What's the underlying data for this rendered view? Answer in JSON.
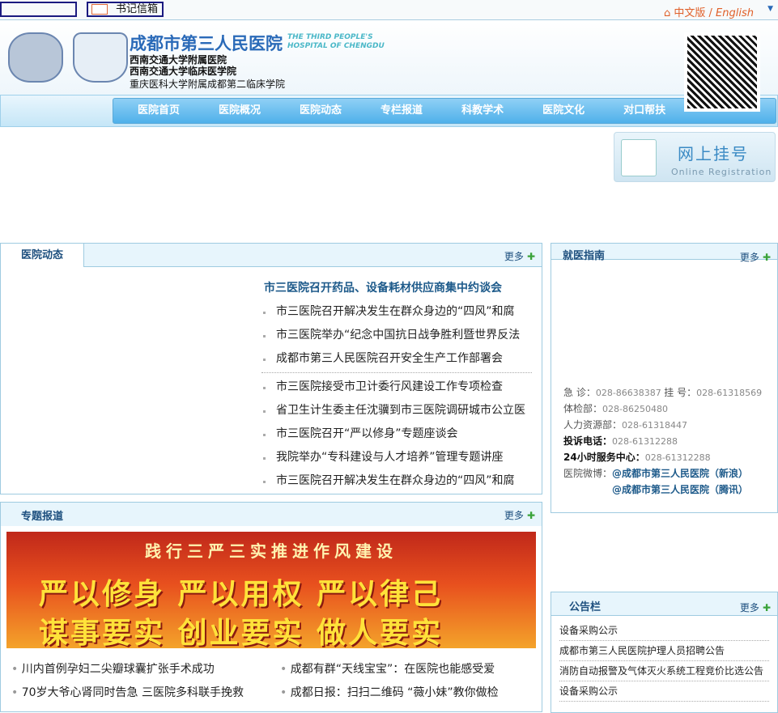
{
  "topbar": {
    "mail_label": "书记信箱",
    "lang_cn": "中文版",
    "lang_sep": " / ",
    "lang_en": "English"
  },
  "header": {
    "title": "成都市第三人民医院",
    "title_en_1": "THE THIRD PEOPLE'S",
    "title_en_2": "HOSPITAL OF CHENGDU",
    "sub1": "西南交通大学附属医院",
    "sub2": "西南交通大学临床医学院",
    "sub3": "重庆医科大学附属成都第二临床学院"
  },
  "nav": [
    "医院首页",
    "医院概况",
    "医院动态",
    "专栏报道",
    "科教学术",
    "医院文化",
    "对口帮扶"
  ],
  "registration": {
    "title": "网上挂号",
    "subtitle": "Online Registration"
  },
  "news": {
    "title": "医院动态",
    "more": "更多",
    "headline": "市三医院召开药品、设备耗材供应商集中约谈会",
    "items": [
      "市三医院召开解决发生在群众身边的“四风”和腐",
      "市三医院举办“纪念中国抗日战争胜利暨世界反法",
      "成都市第三人民医院召开安全生产工作部署会"
    ],
    "items2": [
      "市三医院接受市卫计委行风建设工作专项检查",
      "省卫生计生委主任沈骥到市三医院调研城市公立医",
      "市三医院召开“严以修身”专题座谈会",
      "我院举办“专科建设与人才培养”管理专题讲座",
      "市三医院召开解决发生在群众身边的“四风”和腐"
    ]
  },
  "guide": {
    "title": "就医指南",
    "more": "更多",
    "emergency_label": "急 诊：",
    "emergency": "028-86638387",
    "reg_label": "挂 号：",
    "reg": "028-61318569",
    "checkup_label": "体检部：",
    "checkup": "028-86250480",
    "hr_label": "人力资源部：",
    "hr": "028-61318447",
    "complaint_label": "投诉电话：",
    "complaint": "028-61312288",
    "service_label": "24小时服务中心：",
    "service": "028-61312288",
    "weibo_label": "医院微博：",
    "weibo1": "@成都市第三人民医院（新浪）",
    "weibo2": "@成都市第三人民医院（腾讯）"
  },
  "special": {
    "title": "专题报道",
    "more": "更多",
    "banner1": "践行三严三实推进作风建设",
    "banner2": "严以修身 严以用权 严以律己",
    "banner3": "谋事要实 创业要实 做人要实",
    "items": [
      "川内首例孕妇二尖瓣球囊扩张手术成功",
      "成都有群“天线宝宝”：在医院也能感受爱",
      "70岁大爷心肾同时告急 三医院多科联手挽救",
      "成都日报：扫扫二维码 “薇小妹”教你做检"
    ]
  },
  "notice": {
    "title": "公告栏",
    "more": "更多",
    "items": [
      "设备采购公示",
      "成都市第三人民医院护理人员招聘公告",
      "消防自动报警及气体灭火系统工程竞价比选公告",
      "设备采购公示"
    ]
  }
}
